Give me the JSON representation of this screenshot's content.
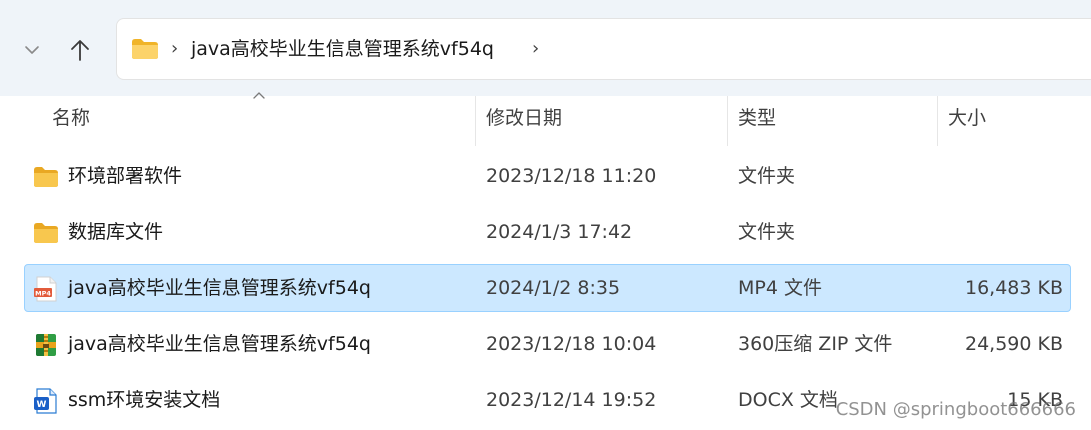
{
  "nav": {
    "path": "java高校毕业生信息管理系统vf54q",
    "separator": "›",
    "separator_end": "›"
  },
  "columns": {
    "name": "名称",
    "modified": "修改日期",
    "type": "类型",
    "size": "大小",
    "sort_indicator": "ascending"
  },
  "files": [
    {
      "name": "环境部署软件",
      "modified": "2023/12/18 11:20",
      "type": "文件夹",
      "size": "",
      "icon": "folder-icon",
      "selected": false
    },
    {
      "name": "数据库文件",
      "modified": "2024/1/3 17:42",
      "type": "文件夹",
      "size": "",
      "icon": "folder-icon",
      "selected": false
    },
    {
      "name": "java高校毕业生信息管理系统vf54q",
      "modified": "2024/1/2 8:35",
      "type": "MP4 文件",
      "size": "16,483 KB",
      "icon": "mp4-file-icon",
      "selected": true
    },
    {
      "name": "java高校毕业生信息管理系统vf54q",
      "modified": "2023/12/18 10:04",
      "type": "360压缩 ZIP 文件",
      "size": "24,590 KB",
      "icon": "zip-archive-icon",
      "selected": false
    },
    {
      "name": "ssm环境安装文档",
      "modified": "2023/12/14 19:52",
      "type": "DOCX 文档",
      "size": "15 KB",
      "icon": "docx-file-icon",
      "selected": false
    }
  ],
  "watermark": "CSDN @springboot666666",
  "colors": {
    "nav_background": "#eff4f9",
    "selection_fill": "#cce8ff",
    "selection_border": "#99d1ff",
    "folder_yellow": "#f8c74e"
  }
}
